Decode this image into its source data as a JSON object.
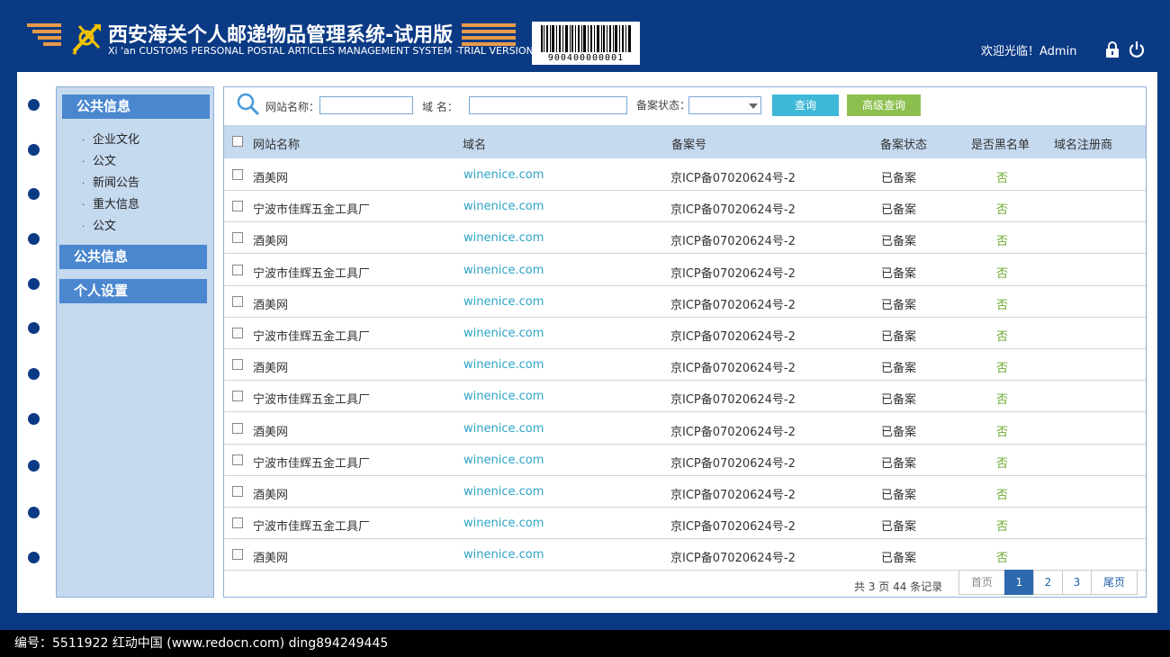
{
  "header": {
    "title_cn": "西安海关个人邮递物品管理系统-试用版",
    "title_en": "Xi 'an CUSTOMS PERSONAL POSTAL ARTICLES  MANAGEMENT SYSTEM -TRIAL VERSION",
    "barcode_number": "900400000001",
    "welcome": "欢迎光临！Admin",
    "lock_icon": "lock-icon",
    "power_icon": "power-icon"
  },
  "sidebar": {
    "section1_title": "公共信息",
    "items": [
      {
        "label": "企业文化"
      },
      {
        "label": "公文"
      },
      {
        "label": "新闻公告"
      },
      {
        "label": "重大信息"
      },
      {
        "label": "公文"
      }
    ],
    "section2_title": "公共信息",
    "section3_title": "个人设置"
  },
  "search": {
    "site_name_label": "网站名称：",
    "site_name_value": "",
    "domain_label": "域    名：",
    "domain_value": "",
    "status_label": "备案状态：",
    "status_value": "",
    "query_button": "查询",
    "advanced_button": "高级查询"
  },
  "table": {
    "headers": [
      "网站名称",
      "域名",
      "备案号",
      "备案状态",
      "是否黑名单",
      "域名注册商"
    ],
    "rows": [
      {
        "name": "酒美网",
        "domain": "winenice.com",
        "icp": "京ICP备07020624号-2",
        "status": "已备案",
        "blacklist": "否",
        "registrar": ""
      },
      {
        "name": "宁波市佳辉五金工具厂",
        "domain": "winenice.com",
        "icp": "京ICP备07020624号-2",
        "status": "已备案",
        "blacklist": "否",
        "registrar": ""
      },
      {
        "name": "酒美网",
        "domain": "winenice.com",
        "icp": "京ICP备07020624号-2",
        "status": "已备案",
        "blacklist": "否",
        "registrar": ""
      },
      {
        "name": "宁波市佳辉五金工具厂",
        "domain": "winenice.com",
        "icp": "京ICP备07020624号-2",
        "status": "已备案",
        "blacklist": "否",
        "registrar": ""
      },
      {
        "name": "酒美网",
        "domain": "winenice.com",
        "icp": "京ICP备07020624号-2",
        "status": "已备案",
        "blacklist": "否",
        "registrar": ""
      },
      {
        "name": "宁波市佳辉五金工具厂",
        "domain": "winenice.com",
        "icp": "京ICP备07020624号-2",
        "status": "已备案",
        "blacklist": "否",
        "registrar": ""
      },
      {
        "name": "酒美网",
        "domain": "winenice.com",
        "icp": "京ICP备07020624号-2",
        "status": "已备案",
        "blacklist": "否",
        "registrar": ""
      },
      {
        "name": "宁波市佳辉五金工具厂",
        "domain": "winenice.com",
        "icp": "京ICP备07020624号-2",
        "status": "已备案",
        "blacklist": "否",
        "registrar": ""
      },
      {
        "name": "酒美网",
        "domain": "winenice.com",
        "icp": "京ICP备07020624号-2",
        "status": "已备案",
        "blacklist": "否",
        "registrar": ""
      },
      {
        "name": "宁波市佳辉五金工具厂",
        "domain": "winenice.com",
        "icp": "京ICP备07020624号-2",
        "status": "已备案",
        "blacklist": "否",
        "registrar": ""
      },
      {
        "name": "酒美网",
        "domain": "winenice.com",
        "icp": "京ICP备07020624号-2",
        "status": "已备案",
        "blacklist": "否",
        "registrar": ""
      },
      {
        "name": "宁波市佳辉五金工具厂",
        "domain": "winenice.com",
        "icp": "京ICP备07020624号-2",
        "status": "已备案",
        "blacklist": "否",
        "registrar": ""
      },
      {
        "name": "酒美网",
        "domain": "winenice.com",
        "icp": "京ICP备07020624号-2",
        "status": "已备案",
        "blacklist": "否",
        "registrar": ""
      }
    ]
  },
  "pagination": {
    "summary": "共 3 页 44 条记录",
    "first": "首页",
    "pages": [
      "1",
      "2",
      "3"
    ],
    "current": "1",
    "last": "尾页"
  },
  "footer": {
    "text": "编号：5511922    红动中国 (www.redocn.com)    ding894249445"
  },
  "colors": {
    "navy": "#0b3a84",
    "sidebar_bg": "#c5d9ef",
    "sidebar_head": "#4a87cf",
    "link": "#2ca3c7",
    "green": "#6aaa2f",
    "query_btn": "#3fb8d8",
    "adv_btn": "#8dbf4e"
  }
}
